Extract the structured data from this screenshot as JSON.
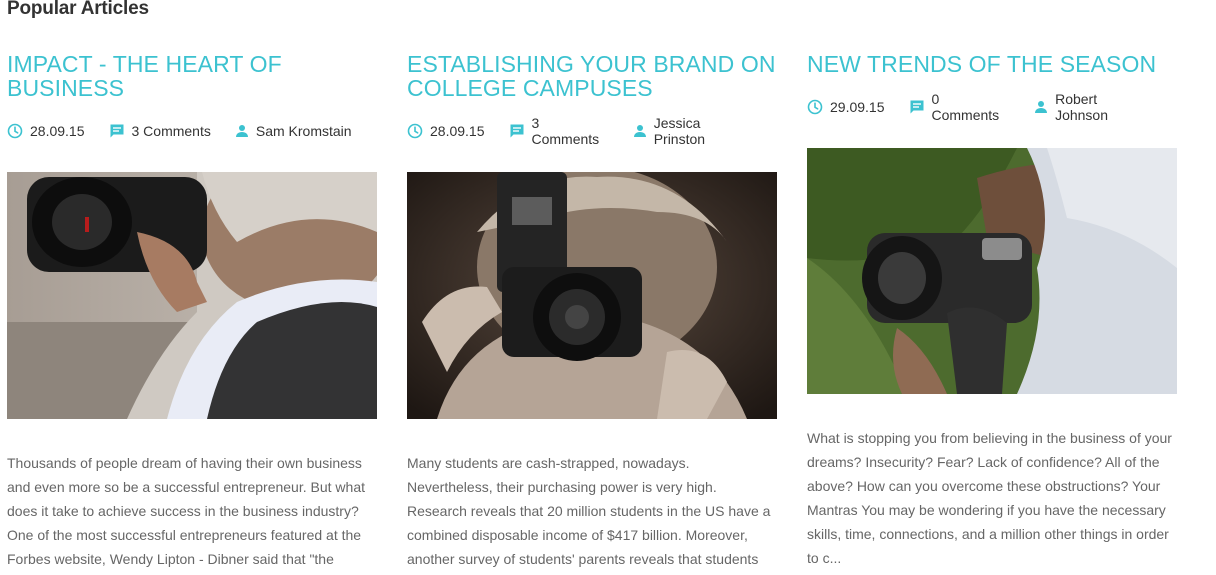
{
  "section": {
    "title": "Popular Articles"
  },
  "colors": {
    "accent": "#3cc2d0",
    "text": "#333333",
    "muted": "#666666"
  },
  "articles": [
    {
      "title": "IMPACT - THE HEART OF BUSINESS",
      "date": "28.09.15",
      "comments": "3 Comments",
      "author": "Sam Kromstain",
      "image": "photographer-with-camera-over-shoulder",
      "excerpt": "Thousands of people dream of having their own business and even more so be a successful entrepreneur. But what does it take to achieve success in the business industry? One of the most successful entrepreneurs featured at the Forbes website, Wendy Lipton - Dibner said that \"the"
    },
    {
      "title": "ESTABLISHING YOUR BRAND ON COLLEGE CAMPUSES",
      "date": "28.09.15",
      "comments": "3 Comments",
      "author": "Jessica Prinston",
      "image": "woman-with-camera-and-flash",
      "excerpt": "Many students are cash-strapped, nowadays. Nevertheless, their purchasing power is very high. Research reveals that 20 million students in the US have a combined disposable income of $417 billion. Moreover, another survey of students' parents reveals that students"
    },
    {
      "title": "NEW TRENDS OF THE SEASON",
      "date": "29.09.15",
      "comments": "0 Comments",
      "author": "Robert Johnson",
      "image": "man-lying-on-grass-with-camera",
      "excerpt": "What is stopping you from believing in the business of your dreams? Insecurity? Fear? Lack of confidence? All of the above? How can you overcome these obstructions? Your Mantras You may be wondering if you have the necessary skills, time, connections, and a million other things in order to c..."
    }
  ]
}
